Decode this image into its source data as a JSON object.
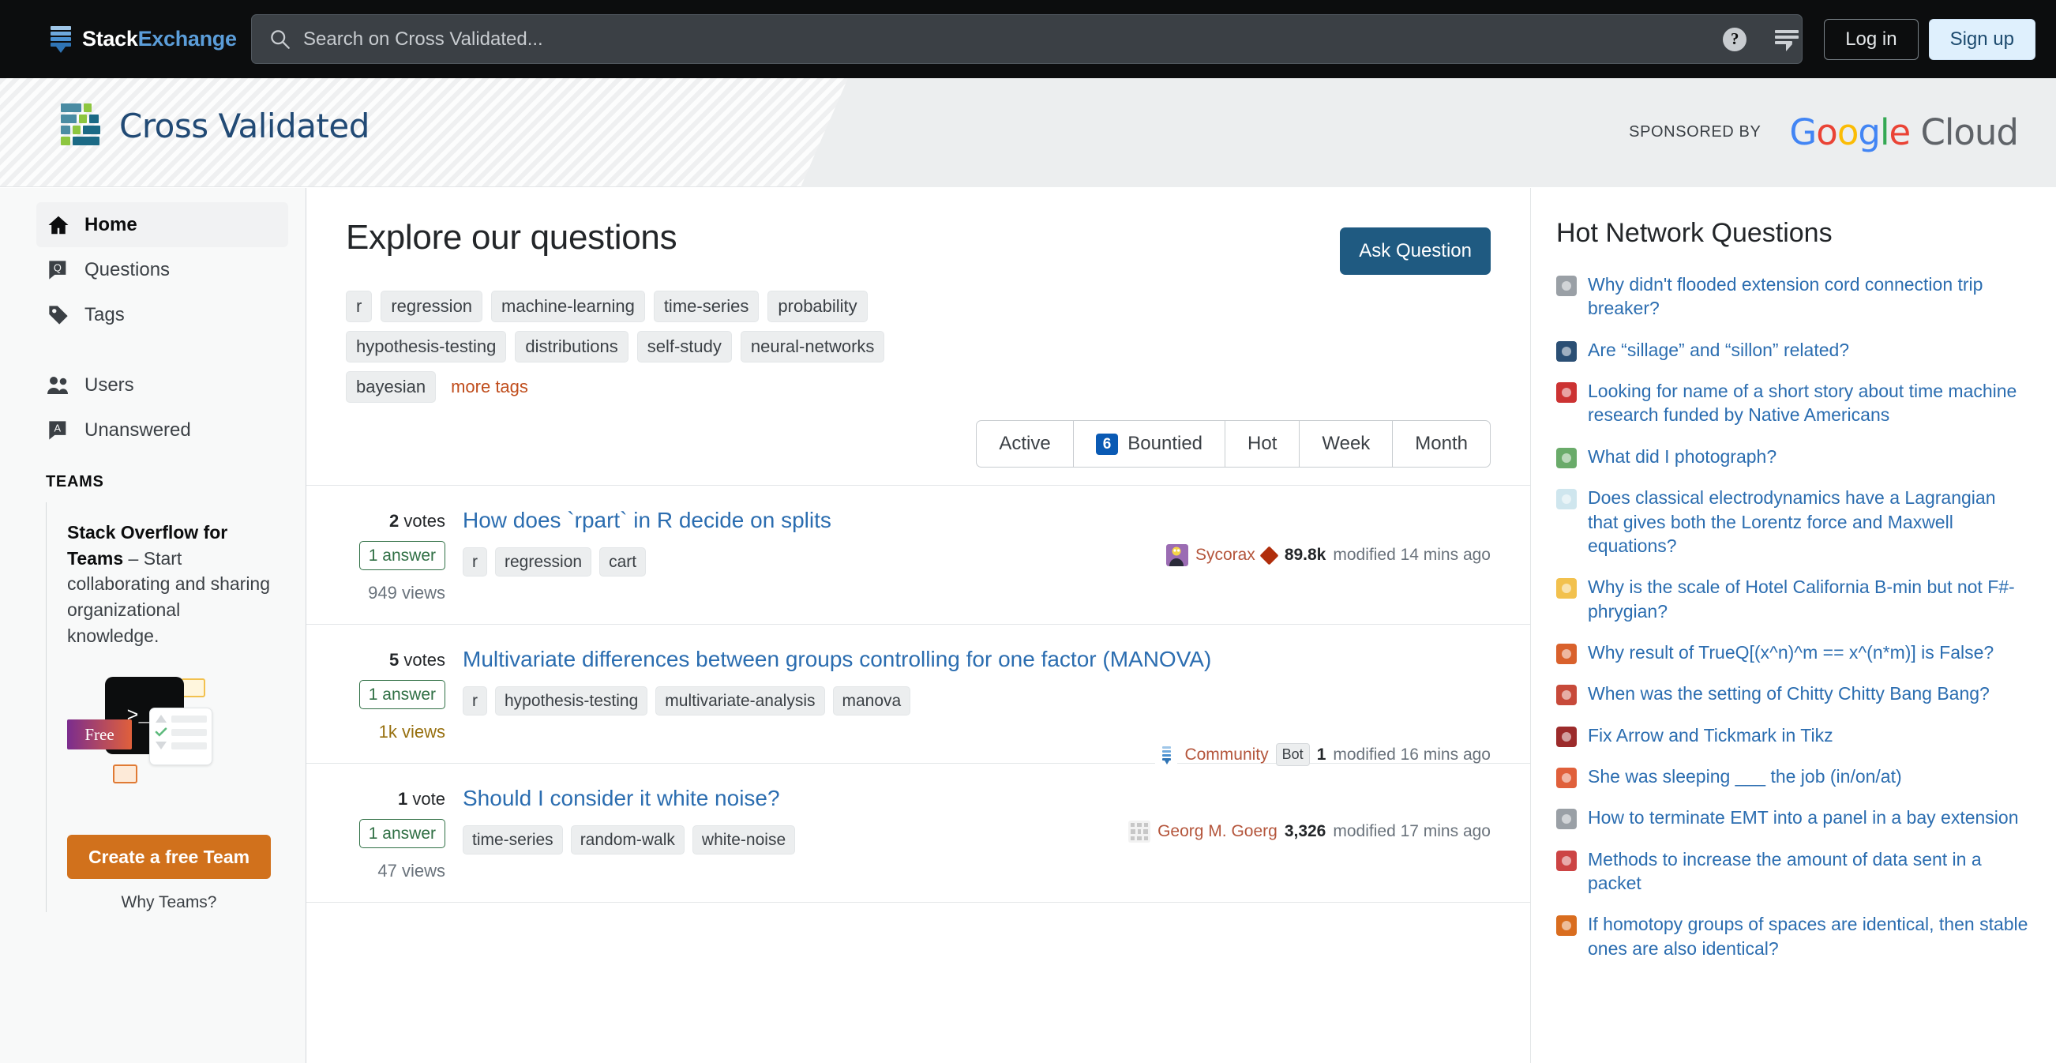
{
  "topbar": {
    "brand_stack": "Stack",
    "brand_exchange": "Exchange",
    "search_placeholder": "Search on Cross Validated...",
    "help_glyph": "?",
    "login_label": "Log in",
    "signup_label": "Sign up"
  },
  "sitebar": {
    "site_name": "Cross Validated",
    "sponsored_by": "SPONSORED BY",
    "sponsor_g1": "G",
    "sponsor_o1": "o",
    "sponsor_o2": "o",
    "sponsor_g2": "g",
    "sponsor_l": "l",
    "sponsor_e": "e",
    "sponsor_cloud": "Cloud"
  },
  "sidebar": {
    "items": [
      {
        "label": "Home",
        "icon": "home-icon",
        "active": true
      },
      {
        "label": "Questions",
        "icon": "question-bubble-icon",
        "active": false
      },
      {
        "label": "Tags",
        "icon": "tag-icon",
        "active": false
      },
      {
        "label": "Users",
        "icon": "users-icon",
        "active": false
      },
      {
        "label": "Unanswered",
        "icon": "unanswered-bubble-icon",
        "active": false
      }
    ],
    "section_title": "TEAMS",
    "teams_title_bold": "Stack Overflow for Teams",
    "teams_title_rest": " – Start collaborating and sharing organizational knowledge.",
    "art_free_label": "Free",
    "art_terminal_glyph": ">_?",
    "create_team_label": "Create a free Team",
    "why_teams_label": "Why Teams?"
  },
  "main": {
    "page_title": "Explore our questions",
    "ask_button": "Ask Question",
    "tags": [
      "r",
      "regression",
      "machine-learning",
      "time-series",
      "probability",
      "hypothesis-testing",
      "distributions",
      "self-study",
      "neural-networks",
      "bayesian"
    ],
    "more_tags": "more tags",
    "filters": [
      {
        "label": "Active",
        "count": null
      },
      {
        "label": "Bountied",
        "count": "6"
      },
      {
        "label": "Hot",
        "count": null
      },
      {
        "label": "Week",
        "count": null
      },
      {
        "label": "Month",
        "count": null
      }
    ],
    "questions": [
      {
        "votes": "2",
        "votes_label": "votes",
        "answers": "1 answer",
        "views": "949 views",
        "views_warm": false,
        "title": "How does `rpart` in R decide on splits",
        "tags": [
          "r",
          "regression",
          "cart"
        ],
        "user": "Sycorax",
        "user_avatar": "homer-avatar",
        "has_diamond": true,
        "is_bot": false,
        "rep": "89.8k",
        "activity": "modified 14 mins ago"
      },
      {
        "votes": "5",
        "votes_label": "votes",
        "answers": "1 answer",
        "views": "1k views",
        "views_warm": true,
        "title": "Multivariate differences between groups controlling for one factor (MANOVA)",
        "tags": [
          "r",
          "hypothesis-testing",
          "multivariate-analysis",
          "manova"
        ],
        "user": "Community",
        "user_avatar": "stack-avatar",
        "has_diamond": false,
        "is_bot": true,
        "bot_label": "Bot",
        "rep": "1",
        "activity": "modified 16 mins ago"
      },
      {
        "votes": "1",
        "votes_label": "vote",
        "answers": "1 answer",
        "views": "47 views",
        "views_warm": false,
        "title": "Should I consider it white noise?",
        "tags": [
          "time-series",
          "random-walk",
          "white-noise"
        ],
        "user": "Georg M. Goerg",
        "user_avatar": "pattern-avatar",
        "has_diamond": false,
        "is_bot": false,
        "rep": "3,326",
        "activity": "modified 17 mins ago"
      }
    ]
  },
  "rightbar": {
    "title": "Hot Network Questions",
    "items": [
      {
        "icon": "electronics-plus-icon",
        "icon_color": "#9aa0a6",
        "text": "Why didn't flooded extension cord connection trip breaker?"
      },
      {
        "icon": "french-se-icon",
        "icon_color": "#2b4f74",
        "text": "Are “sillage” and “sillon” related?"
      },
      {
        "icon": "scifi-se-icon",
        "icon_color": "#c33",
        "text": "Looking for name of a short story about time machine research funded by Native Americans"
      },
      {
        "icon": "photo-se-icon",
        "icon_color": "#6aab6a",
        "text": "What did I photograph?"
      },
      {
        "icon": "physics-se-icon",
        "icon_color": "#cfe6ee",
        "text": "Does classical electrodynamics have a Lagrangian that gives both the Lorentz force and Maxwell equations?"
      },
      {
        "icon": "music-se-icon",
        "icon_color": "#f2c14e",
        "text": "Why is the scale of Hotel California B-min but not F#-phrygian?"
      },
      {
        "icon": "mathematica-se-icon",
        "icon_color": "#d9612c",
        "text": "Why result of TrueQ[(x^n)^m == x^(n*m)] is False?"
      },
      {
        "icon": "movies-se-icon",
        "icon_color": "#c74a3a",
        "text": "When was the setting of Chitty Chitty Bang Bang?"
      },
      {
        "icon": "tex-se-icon",
        "icon_color": "#9c2b2b",
        "text": "Fix Arrow and Tickmark in Tikz"
      },
      {
        "icon": "ell-se-icon",
        "icon_color": "#e0603b",
        "text": "She was sleeping ___ the job (in/on/at)"
      },
      {
        "icon": "electronics-plus-icon",
        "icon_color": "#9aa0a6",
        "text": "How to terminate EMT into a panel in a bay extension"
      },
      {
        "icon": "serverfault-se-icon",
        "icon_color": "#c44",
        "text": "Methods to increase the amount of data sent in a packet"
      },
      {
        "icon": "mathoverflow-icon",
        "icon_color": "#d96d1f",
        "text": "If homotopy groups of spaces are identical, then stable ones are also identical?"
      }
    ]
  },
  "colors": {
    "accent_blue": "#2b6db0",
    "ask_button": "#1f5a81",
    "teams_orange": "#d1711c",
    "answer_green": "#2f6f44",
    "tag_bg": "#eceeef"
  }
}
